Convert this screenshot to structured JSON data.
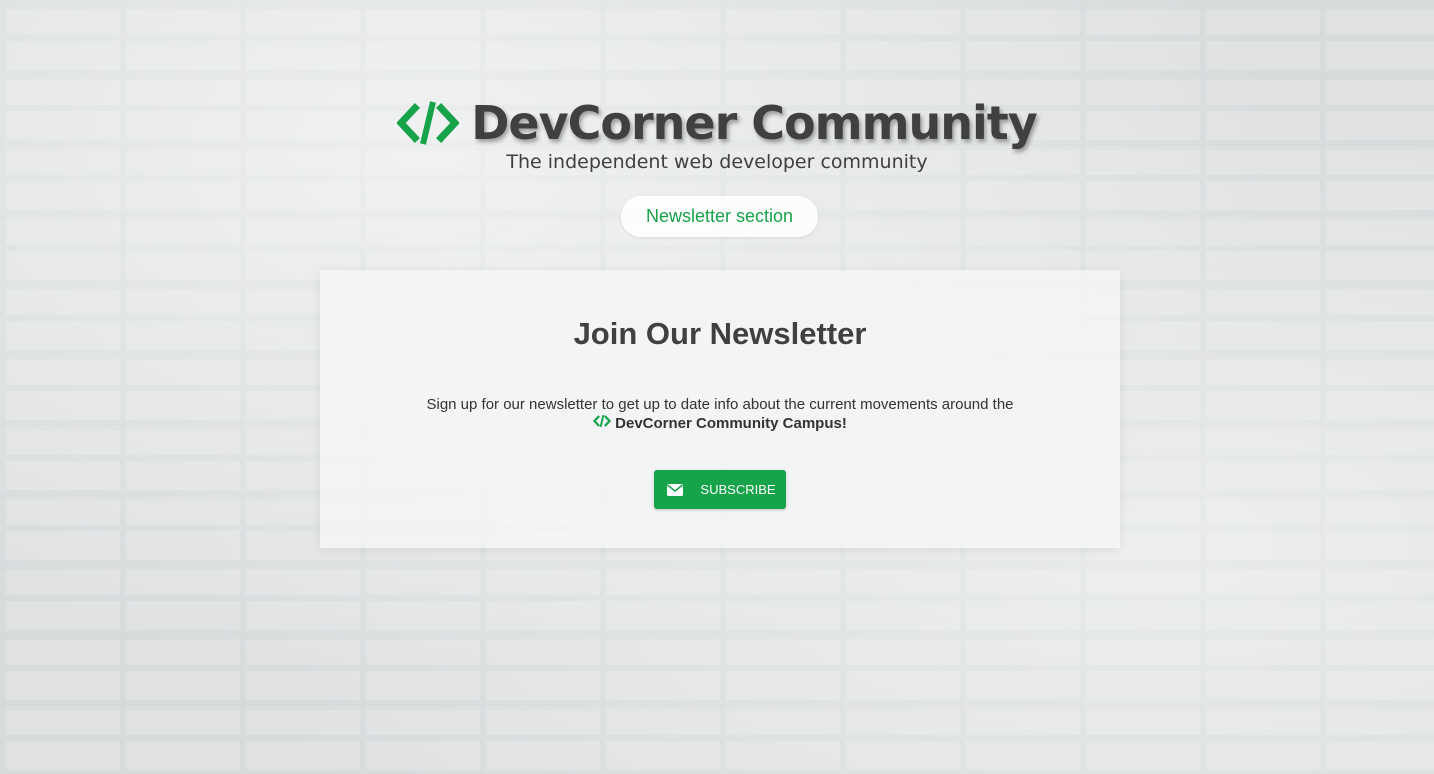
{
  "header": {
    "brand_title": "DevCorner Community",
    "tagline": "The independent web developer community",
    "logo_icon": "code-brackets-icon"
  },
  "nav": {
    "section_label": "Newsletter section"
  },
  "newsletter": {
    "title": "Join Our Newsletter",
    "description": "Sign up for our newsletter to get up to date info about the current movements around the",
    "brand_line": "DevCorner Community Campus!",
    "subscribe_label": "SUBSCRIBE",
    "subscribe_icon": "envelope-icon"
  },
  "colors": {
    "accent": "#16a34a",
    "text": "#404040"
  }
}
